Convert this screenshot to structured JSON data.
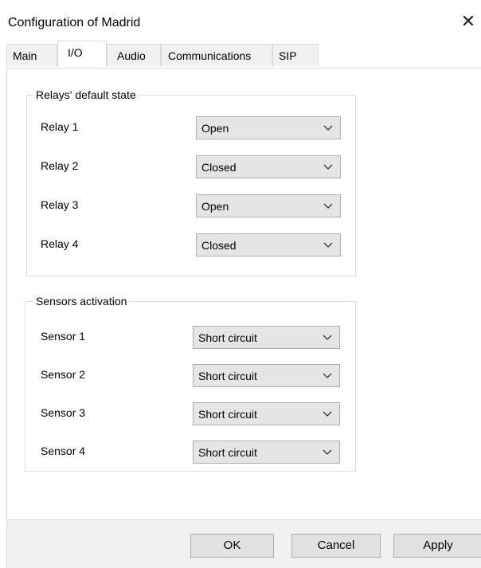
{
  "window": {
    "title": "Configuration of Madrid",
    "close_icon": "close-icon"
  },
  "tabs": [
    {
      "label": "Main",
      "active": false
    },
    {
      "label": "I/O",
      "active": true
    },
    {
      "label": "Audio",
      "active": false
    },
    {
      "label": "Communications",
      "active": false
    },
    {
      "label": "SIP",
      "active": false
    }
  ],
  "relays": {
    "title": "Relays' default state",
    "items": [
      {
        "label": "Relay 1",
        "value": "Open"
      },
      {
        "label": "Relay 2",
        "value": "Closed"
      },
      {
        "label": "Relay 3",
        "value": "Open"
      },
      {
        "label": "Relay 4",
        "value": "Closed"
      }
    ]
  },
  "sensors": {
    "title": "Sensors activation",
    "items": [
      {
        "label": "Sensor 1",
        "value": "Short circuit"
      },
      {
        "label": "Sensor 2",
        "value": "Short circuit"
      },
      {
        "label": "Sensor 3",
        "value": "Short circuit"
      },
      {
        "label": "Sensor 4",
        "value": "Short circuit"
      }
    ]
  },
  "buttons": {
    "ok": "OK",
    "cancel": "Cancel",
    "apply": "Apply"
  },
  "icons": {
    "dropdown": "chevron-down-icon"
  }
}
